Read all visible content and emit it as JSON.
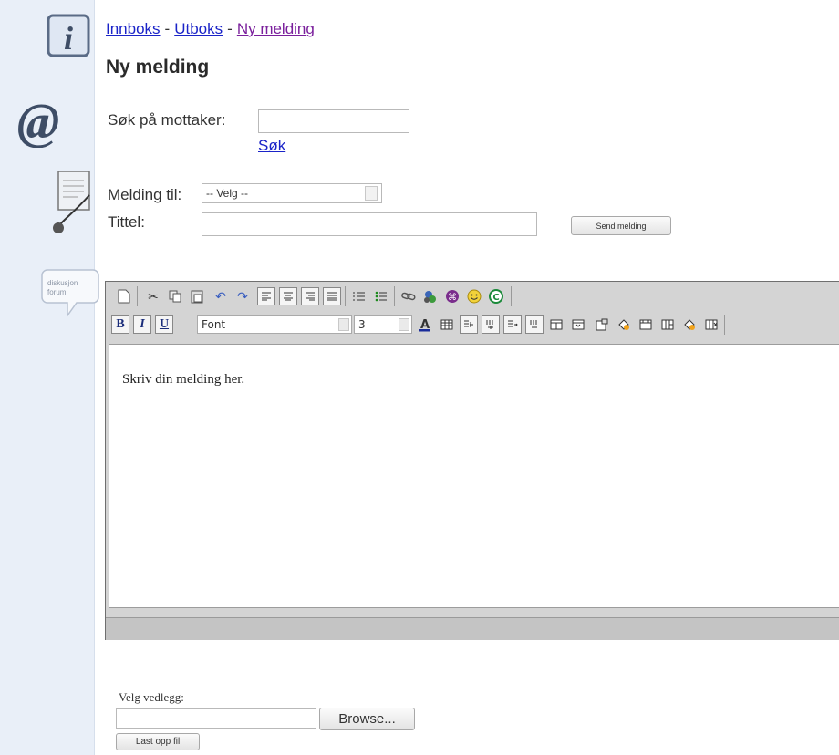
{
  "nav": {
    "inbox": "Innboks",
    "outbox": "Utboks",
    "new_message": "Ny melding",
    "separator": "-"
  },
  "page_title": "Ny melding",
  "search": {
    "label": "Søk på mottaker:",
    "value": "",
    "link": "Søk"
  },
  "form": {
    "to_label": "Melding til:",
    "to_selected": "-- Velg --",
    "title_label": "Tittel:",
    "title_value": "",
    "send_button": "Send melding"
  },
  "sidebar": {
    "forum_icon_text": "diskusjon forum"
  },
  "editor": {
    "toolbar1_icons": [
      "new-document-icon",
      "cut-icon",
      "copy-icon",
      "paste-icon",
      "undo-icon",
      "redo-icon",
      "align-left-icon",
      "align-center-icon",
      "align-right-icon",
      "justify-icon",
      "ordered-list-icon",
      "unordered-list-icon",
      "link-icon",
      "image-icon",
      "special-char-icon",
      "smiley-icon",
      "copyright-icon"
    ],
    "bold_label": "B",
    "italic_label": "I",
    "underline_label": "U",
    "font_value": "Font",
    "size_value": "3",
    "placeholder_text": "Skriv din melding her."
  },
  "attachment": {
    "label": "Velg vedlegg:",
    "browse_button": "Browse...",
    "upload_button": "Last opp fil"
  },
  "colors": {
    "link": "#1a23c8",
    "visited_link": "#7a1f9c",
    "sidebar_bg": "#e9eff8",
    "toolbar_bg": "#d4d4d4"
  }
}
